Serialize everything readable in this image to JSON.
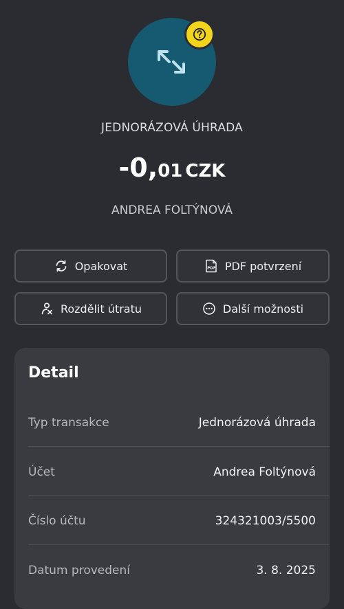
{
  "transaction": {
    "type_label": "JEDNORÁZOVÁ ÚHRADA",
    "amount_whole": "-0,",
    "amount_decimal": "01",
    "currency": "CZK",
    "counterparty": "ANDREA FOLTÝNOVÁ",
    "icon": "transfer-arrows-icon",
    "badge_icon": "question-icon",
    "colors": {
      "icon_bg": "#165a72",
      "badge": "#f2d41d",
      "background": "#2b2c31"
    }
  },
  "actions": {
    "repeat": {
      "label": "Opakovat",
      "icon": "refresh-icon"
    },
    "pdf": {
      "label": "PDF potvrzení",
      "icon": "pdf-icon"
    },
    "split": {
      "label": "Rozdělit útratu",
      "icon": "split-person-icon"
    },
    "more": {
      "label": "Další možnosti",
      "icon": "more-icon"
    }
  },
  "detail": {
    "title": "Detail",
    "rows": [
      {
        "label": "Typ transakce",
        "value": "Jednorázová úhrada"
      },
      {
        "label": "Účet",
        "value": "Andrea Foltýnová"
      },
      {
        "label": "Číslo účtu",
        "value": "324321003/5500"
      },
      {
        "label": "Datum provedení",
        "value": "3. 8. 2025"
      }
    ]
  }
}
